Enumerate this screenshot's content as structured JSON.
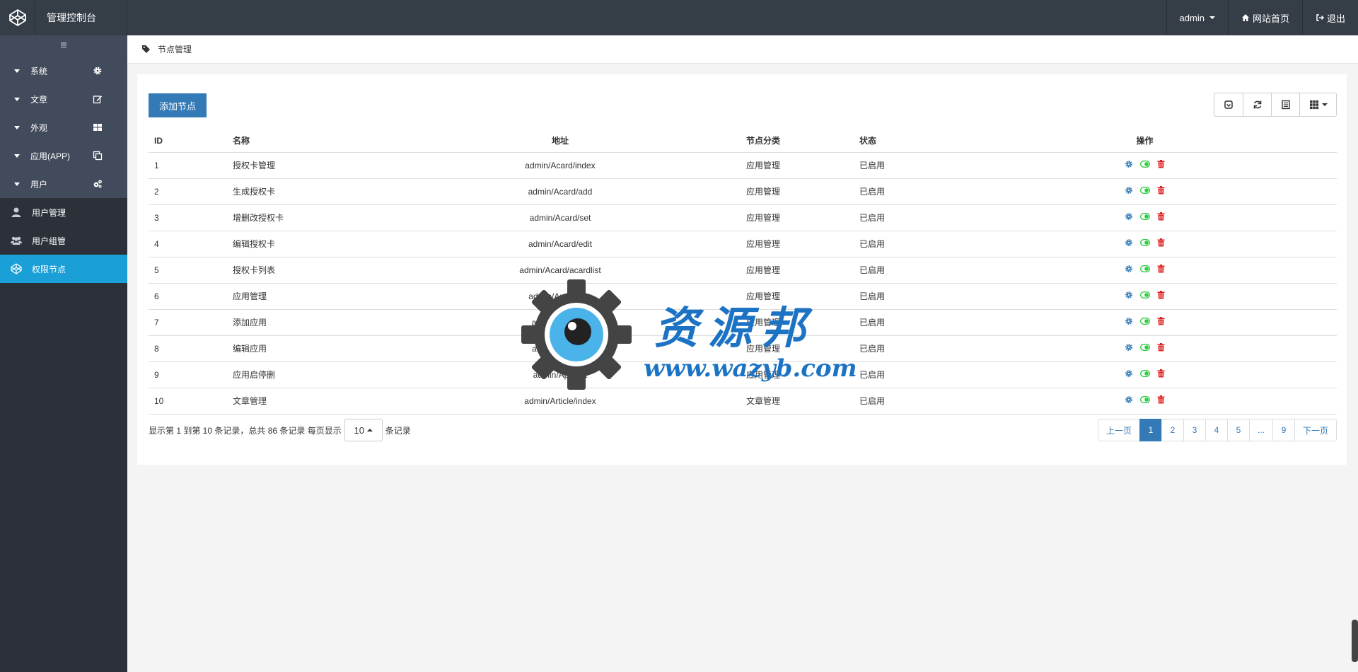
{
  "app": {
    "title": "管理控制台"
  },
  "topnav": {
    "user": "admin",
    "home": "网站首页",
    "logout": "退出"
  },
  "sidebar": {
    "toggle": "≡",
    "groups": [
      {
        "label": "系统",
        "icon": "gear-icon"
      },
      {
        "label": "文章",
        "icon": "edit-icon"
      },
      {
        "label": "外观",
        "icon": "grid-icon"
      },
      {
        "label": "应用(APP)",
        "icon": "copy-icon"
      },
      {
        "label": "用户",
        "icon": "gears-icon"
      }
    ],
    "subitems": [
      {
        "label": "用户管理",
        "icon": "user-icon"
      },
      {
        "label": "用户组管",
        "icon": "users-icon"
      },
      {
        "label": "权限节点",
        "icon": "codepen-icon"
      }
    ]
  },
  "breadcrumb": {
    "label": "节点管理",
    "icon": "tag-icon"
  },
  "toolbar": {
    "add_label": "添加节点"
  },
  "table": {
    "headers": [
      "ID",
      "名称",
      "地址",
      "节点分类",
      "状态",
      "操作"
    ],
    "rows": [
      {
        "id": "1",
        "name": "授权卡管理",
        "addr": "admin/Acard/index",
        "cat": "应用管理",
        "status": "已启用"
      },
      {
        "id": "2",
        "name": "生成授权卡",
        "addr": "admin/Acard/add",
        "cat": "应用管理",
        "status": "已启用"
      },
      {
        "id": "3",
        "name": "增删改授权卡",
        "addr": "admin/Acard/set",
        "cat": "应用管理",
        "status": "已启用"
      },
      {
        "id": "4",
        "name": "编辑授权卡",
        "addr": "admin/Acard/edit",
        "cat": "应用管理",
        "status": "已启用"
      },
      {
        "id": "5",
        "name": "授权卡列表",
        "addr": "admin/Acard/acardlist",
        "cat": "应用管理",
        "status": "已启用"
      },
      {
        "id": "6",
        "name": "应用管理",
        "addr": "admin/App/index",
        "cat": "应用管理",
        "status": "已启用"
      },
      {
        "id": "7",
        "name": "添加应用",
        "addr": "admin/App/add",
        "cat": "应用管理",
        "status": "已启用"
      },
      {
        "id": "8",
        "name": "编辑应用",
        "addr": "admin/App/edit",
        "cat": "应用管理",
        "status": "已启用"
      },
      {
        "id": "9",
        "name": "应用启停删",
        "addr": "admin/App/set",
        "cat": "应用管理",
        "status": "已启用"
      },
      {
        "id": "10",
        "name": "文章管理",
        "addr": "admin/Article/index",
        "cat": "文章管理",
        "status": "已启用"
      }
    ]
  },
  "footer": {
    "info_prefix": "显示第 1 到第 10 条记录，总共 86 条记录 每页显示",
    "page_size": "10",
    "info_suffix": "条记录"
  },
  "pager": {
    "prev": "上一页",
    "pages": [
      "1",
      "2",
      "3",
      "4",
      "5",
      "...",
      "9"
    ],
    "next": "下一页",
    "active": "1"
  },
  "watermark": {
    "cn": "资源邦",
    "url": "www.wazyb.com"
  },
  "colors": {
    "topbar": "#353d47",
    "sidebar": "#2b3039",
    "sidebar_group": "#414b5b",
    "active": "#1a9fd6",
    "primary": "#337ab7",
    "toggle_on": "#2ecc40",
    "delete": "#e02020"
  }
}
